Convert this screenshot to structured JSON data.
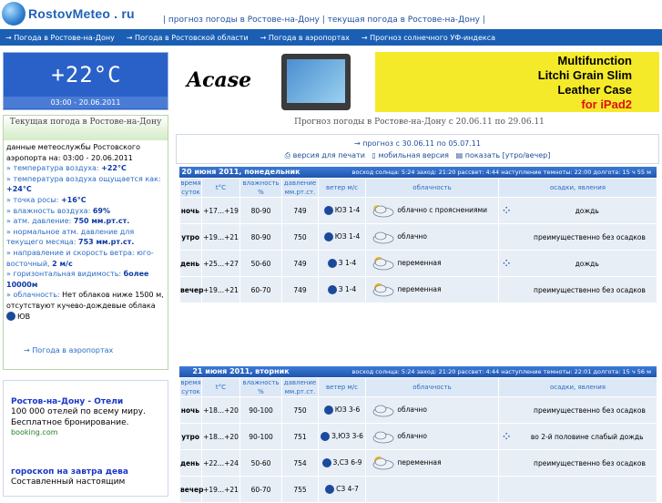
{
  "header": {
    "logo": "RostovMeteo . ru",
    "links": "| прогноз погоды в Ростове-на-Дону | текущая погода в Ростове-на-Дону |"
  },
  "nav": [
    "→ Погода в Ростове-на-Дону",
    "→ Погода в Ростовской области",
    "→ Погода в аэропортах",
    "→ Прогноз солнечного УФ-индекса"
  ],
  "current": {
    "temp": "+22°C",
    "time": "03:00 - 20.06.2011",
    "title": "Текущая погода в Ростове-на-Дону",
    "intro": "данные метеослужбы Ростовского аэропорта на: 03:00 - 20.06.2011",
    "lines": [
      {
        "k": "» температура воздуха:",
        "v": "+22°C"
      },
      {
        "k": "» температура воздуха ощущается как:",
        "v": "+24°C"
      },
      {
        "k": "» точка росы:",
        "v": "+16°C"
      },
      {
        "k": "» влажность воздуха:",
        "v": "69%"
      },
      {
        "k": "» атм. давление:",
        "v": "750 мм.рт.ст."
      },
      {
        "k": "» нормальное атм. давление для текущего месяца:",
        "v": "753 мм.рт.ст."
      },
      {
        "k": "» направление и скорость ветра: юго-восточный,",
        "v": "2 м/с"
      },
      {
        "k": "» горизонтальная видимость:",
        "v": "более 10000м"
      },
      {
        "k": "» облачность:",
        "v": "Нет облаков ниже 1500 м, отсутствуют кучево-дождевые облака"
      }
    ],
    "wind_dir": "ЮВ",
    "link": "→ Погода в аэропортах"
  },
  "ads": [
    {
      "title": "Ростов-на-Дону - Отели",
      "desc": "100 000 отелей по всему миру. Бесплатное бронирование.",
      "site": "booking.com"
    },
    {
      "title": "гороскоп на завтра дева",
      "desc": "Составленный настоящим"
    }
  ],
  "banner1": {
    "brand": "Acase"
  },
  "banner2": {
    "l1": "Multifunction",
    "l2": "Litchi Grain Slim",
    "l3": "Leather Case",
    "l4": "for iPad2"
  },
  "forecast_title": "Прогноз погоды в Ростове-на-Дону с 20.06.11 по 29.06.11",
  "options": {
    "next": "→ прогноз с 30.06.11 по 05.07.11",
    "print": "версия для печати",
    "mobile": "мобильная версия",
    "toggle": "показать [утро/вечер]"
  },
  "columns": {
    "time": "время суток",
    "t": "t°C",
    "hum": "влажность %",
    "press": "давление мм.рт.ст.",
    "wind": "ветер м/с",
    "cloud": "облачность",
    "prec": "осадки, явления"
  },
  "days": [
    {
      "title": "20 июня 2011, понедельник",
      "info": "восход солнца: 5:24   заход: 21:20   рассвет: 4:44   наступление темноты: 22:00   долгота: 15 ч 55 м",
      "rows": [
        {
          "p": "ночь",
          "t": "+17...+19",
          "h": "80-90",
          "pr": "749",
          "w": "ЮЗ",
          "ws": "1-4",
          "cl": "облачно с прояснениями",
          "pc": "дождь",
          "drops": true
        },
        {
          "p": "утро",
          "t": "+19...+21",
          "h": "80-90",
          "pr": "750",
          "w": "ЮЗ",
          "ws": "1-4",
          "cl": "облачно",
          "pc": "преимущественно без осадков",
          "drops": false
        },
        {
          "p": "день",
          "t": "+25...+27",
          "h": "50-60",
          "pr": "749",
          "w": "З",
          "ws": "1-4",
          "cl": "переменная",
          "pc": "дождь",
          "drops": true
        },
        {
          "p": "вечер",
          "t": "+19...+21",
          "h": "60-70",
          "pr": "749",
          "w": "З",
          "ws": "1-4",
          "cl": "переменная",
          "pc": "преимущественно без осадков",
          "drops": false
        }
      ]
    },
    {
      "title": "21 июня 2011, вторник",
      "info": "восход солнца: 5:24   заход: 21:20   рассвет: 4:44   наступление темноты: 22:01   долгота: 15 ч 56 м",
      "rows": [
        {
          "p": "ночь",
          "t": "+18...+20",
          "h": "90-100",
          "pr": "750",
          "w": "ЮЗ",
          "ws": "3-6",
          "cl": "облачно",
          "pc": "преимущественно без осадков",
          "drops": false
        },
        {
          "p": "утро",
          "t": "+18...+20",
          "h": "90-100",
          "pr": "751",
          "w": "З,ЮЗ",
          "ws": "3-6",
          "cl": "облачно",
          "pc": "во 2-й половине слабый дождь",
          "drops": true
        },
        {
          "p": "день",
          "t": "+22...+24",
          "h": "50-60",
          "pr": "754",
          "w": "З,СЗ",
          "ws": "6-9",
          "cl": "переменная",
          "pc": "преимущественно без осадков",
          "drops": false
        },
        {
          "p": "вечер",
          "t": "+19...+21",
          "h": "60-70",
          "pr": "755",
          "w": "СЗ",
          "ws": "4-7",
          "cl": "",
          "pc": "",
          "drops": false
        }
      ]
    }
  ]
}
